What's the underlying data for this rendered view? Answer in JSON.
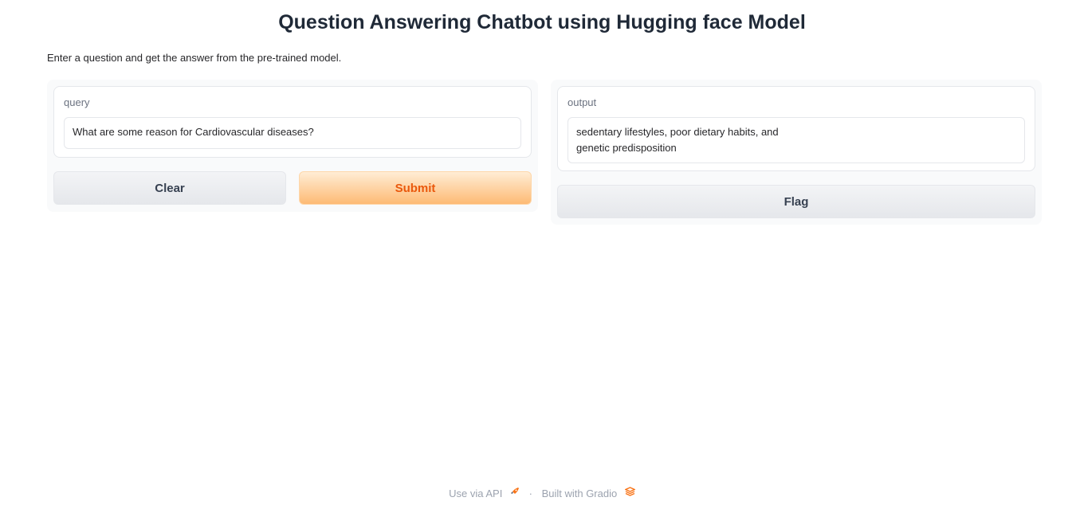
{
  "page": {
    "title": "Question Answering Chatbot using Hugging face Model",
    "description": "Enter a question and get the answer from the pre-trained model."
  },
  "input_panel": {
    "query_label": "query",
    "query_value": "What are some reason for Cardiovascular diseases?",
    "clear_label": "Clear",
    "submit_label": "Submit"
  },
  "output_panel": {
    "output_label": "output",
    "output_line1": "sedentary lifestyles, poor dietary habits, and",
    "output_line2": "genetic predisposition",
    "flag_label": "Flag"
  },
  "footer": {
    "api_label": "Use via API",
    "api_icon": "rocket-icon",
    "separator": "·",
    "built_label": "Built with Gradio",
    "gradio_icon": "gradio-logo-icon"
  },
  "colors": {
    "primary_text": "#ea580c",
    "primary_bg_start": "#ffedd5",
    "primary_bg_end": "#fdba74",
    "secondary_bg": "#e5e7eb",
    "panel_bg": "#f9fafb"
  }
}
